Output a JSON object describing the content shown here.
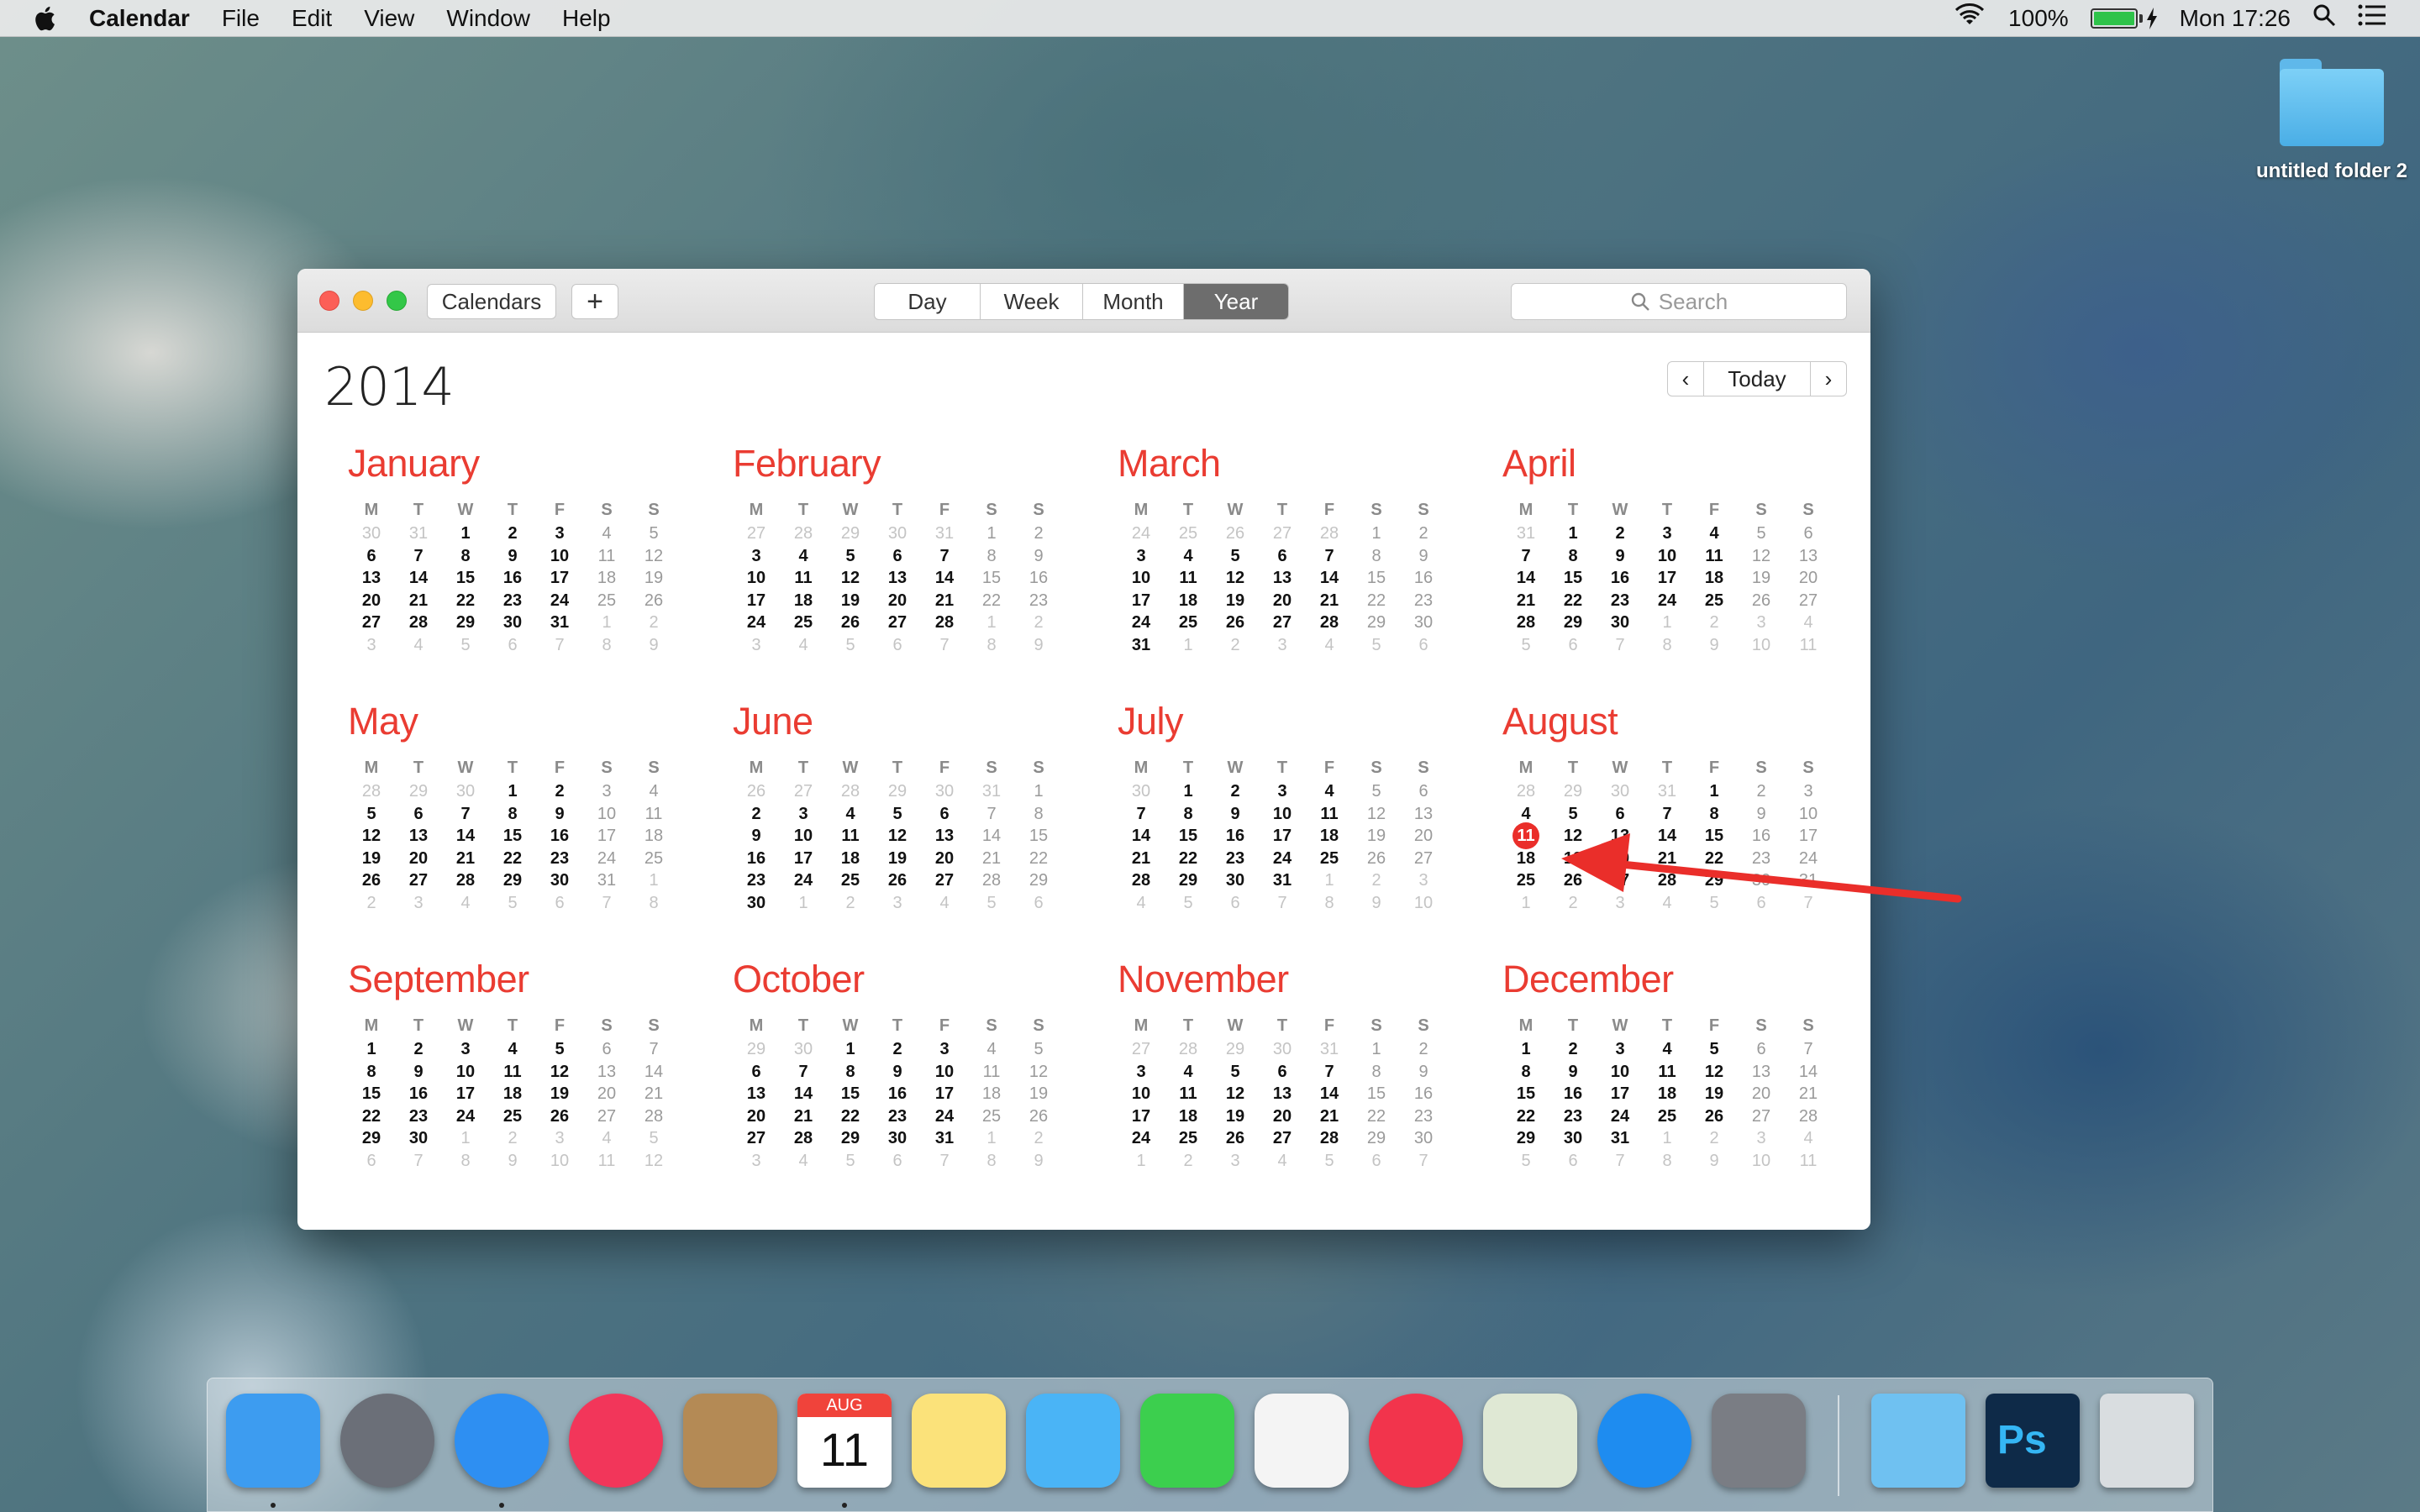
{
  "menubar": {
    "app_name": "Calendar",
    "menus": [
      "File",
      "Edit",
      "View",
      "Window",
      "Help"
    ],
    "battery_percent": "100%",
    "clock": "Mon 17:26"
  },
  "desktop": {
    "folder_label": "untitled folder 2"
  },
  "window": {
    "calendars_button": "Calendars",
    "add_button": "+",
    "views": [
      "Day",
      "Week",
      "Month",
      "Year"
    ],
    "active_view": "Year",
    "search_placeholder": "Search",
    "year": "2014",
    "today_button": "Today",
    "prev_arrow": "‹",
    "next_arrow": "›"
  },
  "weekday_headers": [
    "M",
    "T",
    "W",
    "T",
    "F",
    "S",
    "S"
  ],
  "today": {
    "month": "August",
    "day": 11
  },
  "months": [
    {
      "name": "January",
      "days": [
        [
          30,
          31,
          1,
          2,
          3,
          4,
          5
        ],
        [
          6,
          7,
          8,
          9,
          10,
          11,
          12
        ],
        [
          13,
          14,
          15,
          16,
          17,
          18,
          19
        ],
        [
          20,
          21,
          22,
          23,
          24,
          25,
          26
        ],
        [
          27,
          28,
          29,
          30,
          31,
          1,
          2
        ],
        [
          3,
          4,
          5,
          6,
          7,
          8,
          9
        ]
      ],
      "lead": 2
    },
    {
      "name": "February",
      "days": [
        [
          27,
          28,
          29,
          30,
          31,
          1,
          2
        ],
        [
          3,
          4,
          5,
          6,
          7,
          8,
          9
        ],
        [
          10,
          11,
          12,
          13,
          14,
          15,
          16
        ],
        [
          17,
          18,
          19,
          20,
          21,
          22,
          23
        ],
        [
          24,
          25,
          26,
          27,
          28,
          1,
          2
        ],
        [
          3,
          4,
          5,
          6,
          7,
          8,
          9
        ]
      ],
      "lead": 5
    },
    {
      "name": "March",
      "days": [
        [
          24,
          25,
          26,
          27,
          28,
          1,
          2
        ],
        [
          3,
          4,
          5,
          6,
          7,
          8,
          9
        ],
        [
          10,
          11,
          12,
          13,
          14,
          15,
          16
        ],
        [
          17,
          18,
          19,
          20,
          21,
          22,
          23
        ],
        [
          24,
          25,
          26,
          27,
          28,
          29,
          30
        ],
        [
          31,
          1,
          2,
          3,
          4,
          5,
          6
        ]
      ],
      "lead": 5
    },
    {
      "name": "April",
      "days": [
        [
          31,
          1,
          2,
          3,
          4,
          5,
          6
        ],
        [
          7,
          8,
          9,
          10,
          11,
          12,
          13
        ],
        [
          14,
          15,
          16,
          17,
          18,
          19,
          20
        ],
        [
          21,
          22,
          23,
          24,
          25,
          26,
          27
        ],
        [
          28,
          29,
          30,
          1,
          2,
          3,
          4
        ],
        [
          5,
          6,
          7,
          8,
          9,
          10,
          11
        ]
      ],
      "lead": 1
    },
    {
      "name": "May",
      "days": [
        [
          28,
          29,
          30,
          1,
          2,
          3,
          4
        ],
        [
          5,
          6,
          7,
          8,
          9,
          10,
          11
        ],
        [
          12,
          13,
          14,
          15,
          16,
          17,
          18
        ],
        [
          19,
          20,
          21,
          22,
          23,
          24,
          25
        ],
        [
          26,
          27,
          28,
          29,
          30,
          31,
          1
        ],
        [
          2,
          3,
          4,
          5,
          6,
          7,
          8
        ]
      ],
      "lead": 3
    },
    {
      "name": "June",
      "days": [
        [
          26,
          27,
          28,
          29,
          30,
          31,
          1
        ],
        [
          2,
          3,
          4,
          5,
          6,
          7,
          8
        ],
        [
          9,
          10,
          11,
          12,
          13,
          14,
          15
        ],
        [
          16,
          17,
          18,
          19,
          20,
          21,
          22
        ],
        [
          23,
          24,
          25,
          26,
          27,
          28,
          29
        ],
        [
          30,
          1,
          2,
          3,
          4,
          5,
          6
        ]
      ],
      "lead": 6
    },
    {
      "name": "July",
      "days": [
        [
          30,
          1,
          2,
          3,
          4,
          5,
          6
        ],
        [
          7,
          8,
          9,
          10,
          11,
          12,
          13
        ],
        [
          14,
          15,
          16,
          17,
          18,
          19,
          20
        ],
        [
          21,
          22,
          23,
          24,
          25,
          26,
          27
        ],
        [
          28,
          29,
          30,
          31,
          1,
          2,
          3
        ],
        [
          4,
          5,
          6,
          7,
          8,
          9,
          10
        ]
      ],
      "lead": 1
    },
    {
      "name": "August",
      "days": [
        [
          28,
          29,
          30,
          31,
          1,
          2,
          3
        ],
        [
          4,
          5,
          6,
          7,
          8,
          9,
          10
        ],
        [
          11,
          12,
          13,
          14,
          15,
          16,
          17
        ],
        [
          18,
          19,
          20,
          21,
          22,
          23,
          24
        ],
        [
          25,
          26,
          27,
          28,
          29,
          30,
          31
        ],
        [
          1,
          2,
          3,
          4,
          5,
          6,
          7
        ]
      ],
      "lead": 4
    },
    {
      "name": "September",
      "days": [
        [
          1,
          2,
          3,
          4,
          5,
          6,
          7
        ],
        [
          8,
          9,
          10,
          11,
          12,
          13,
          14
        ],
        [
          15,
          16,
          17,
          18,
          19,
          20,
          21
        ],
        [
          22,
          23,
          24,
          25,
          26,
          27,
          28
        ],
        [
          29,
          30,
          1,
          2,
          3,
          4,
          5
        ],
        [
          6,
          7,
          8,
          9,
          10,
          11,
          12
        ]
      ],
      "lead": 0
    },
    {
      "name": "October",
      "days": [
        [
          29,
          30,
          1,
          2,
          3,
          4,
          5
        ],
        [
          6,
          7,
          8,
          9,
          10,
          11,
          12
        ],
        [
          13,
          14,
          15,
          16,
          17,
          18,
          19
        ],
        [
          20,
          21,
          22,
          23,
          24,
          25,
          26
        ],
        [
          27,
          28,
          29,
          30,
          31,
          1,
          2
        ],
        [
          3,
          4,
          5,
          6,
          7,
          8,
          9
        ]
      ],
      "lead": 2
    },
    {
      "name": "November",
      "days": [
        [
          27,
          28,
          29,
          30,
          31,
          1,
          2
        ],
        [
          3,
          4,
          5,
          6,
          7,
          8,
          9
        ],
        [
          10,
          11,
          12,
          13,
          14,
          15,
          16
        ],
        [
          17,
          18,
          19,
          20,
          21,
          22,
          23
        ],
        [
          24,
          25,
          26,
          27,
          28,
          29,
          30
        ],
        [
          1,
          2,
          3,
          4,
          5,
          6,
          7
        ]
      ],
      "lead": 5
    },
    {
      "name": "December",
      "days": [
        [
          1,
          2,
          3,
          4,
          5,
          6,
          7
        ],
        [
          8,
          9,
          10,
          11,
          12,
          13,
          14
        ],
        [
          15,
          16,
          17,
          18,
          19,
          20,
          21
        ],
        [
          22,
          23,
          24,
          25,
          26,
          27,
          28
        ],
        [
          29,
          30,
          31,
          1,
          2,
          3,
          4
        ],
        [
          5,
          6,
          7,
          8,
          9,
          10,
          11
        ]
      ],
      "lead": 0
    }
  ],
  "dock": {
    "apps": [
      {
        "name": "finder-icon",
        "color": "#3d9cf0",
        "running": true
      },
      {
        "name": "launchpad-icon",
        "color": "#6b6f78",
        "running": false
      },
      {
        "name": "safari-icon",
        "color": "#2e8ff2",
        "running": true
      },
      {
        "name": "mail-icon",
        "color": "#f2365a",
        "running": false
      },
      {
        "name": "contacts-icon",
        "color": "#b48a55",
        "running": false
      },
      {
        "name": "calendar-icon",
        "color": "#ffffff",
        "running": true
      },
      {
        "name": "notes-icon",
        "color": "#fbe27a",
        "running": false
      },
      {
        "name": "messages-icon",
        "color": "#4ab4f6",
        "running": false
      },
      {
        "name": "facetime-icon",
        "color": "#3ccf4e",
        "running": false
      },
      {
        "name": "reminders-icon",
        "color": "#f4f4f4",
        "running": false
      },
      {
        "name": "itunes-icon",
        "color": "#f2344c",
        "running": false
      },
      {
        "name": "maps-icon",
        "color": "#dfe8d4",
        "running": false
      },
      {
        "name": "app-store-icon",
        "color": "#1e8cf0",
        "running": false
      },
      {
        "name": "system-preferences-icon",
        "color": "#7a7d84",
        "running": false
      }
    ],
    "right_items": [
      {
        "name": "downloads-folder-icon",
        "color": "#6fc1f1"
      },
      {
        "name": "photoshop-icon",
        "color": "#0e2a48"
      },
      {
        "name": "trash-icon",
        "color": "#d9dde0"
      }
    ],
    "calendar_icon_month": "AUG",
    "calendar_icon_day": "11",
    "photoshop_label": "Ps"
  },
  "colors": {
    "accent_red": "#ea3c32",
    "today_red": "#ea2e2a",
    "annotation_arrow": "#ea2e2a"
  }
}
